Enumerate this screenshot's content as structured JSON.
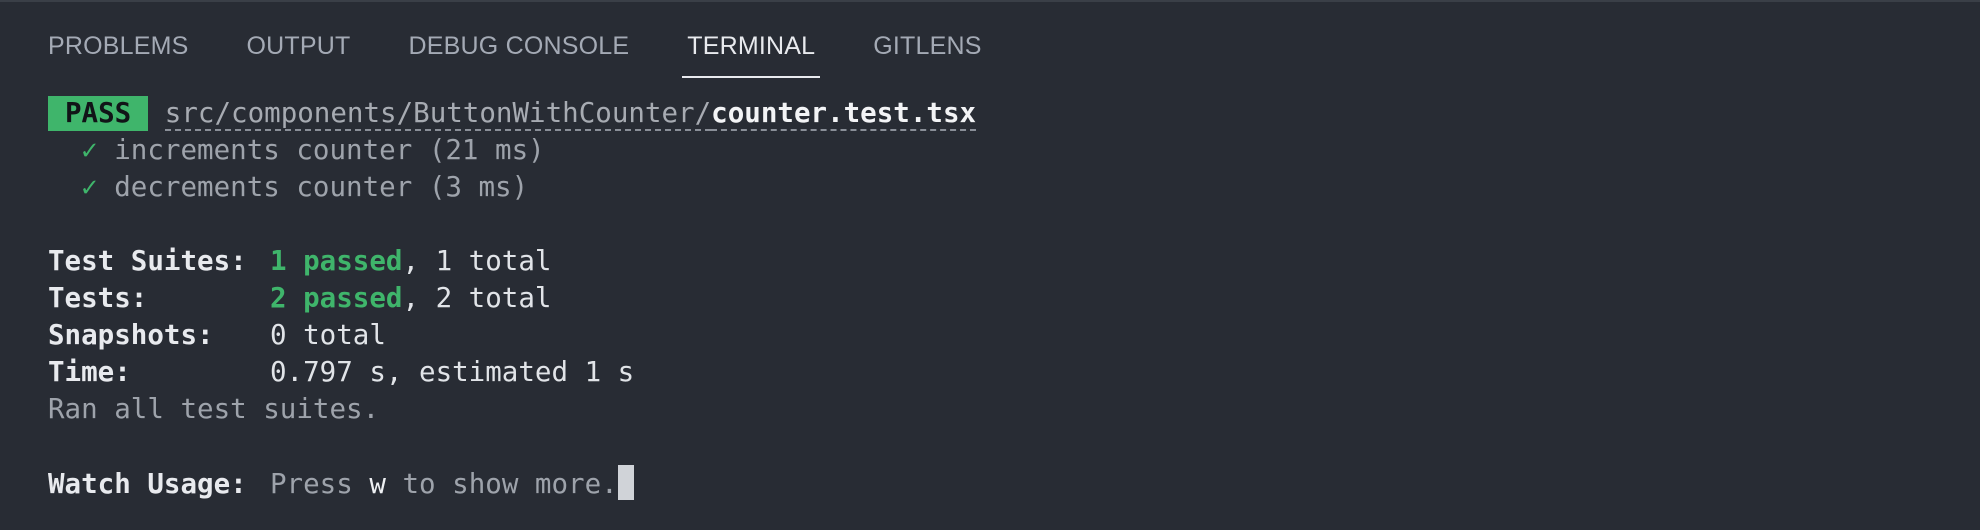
{
  "tabs": [
    {
      "label": "PROBLEMS"
    },
    {
      "label": "OUTPUT"
    },
    {
      "label": "DEBUG CONSOLE"
    },
    {
      "label": "TERMINAL",
      "active": true
    },
    {
      "label": "GITLENS"
    }
  ],
  "terminal": {
    "badge": "PASS",
    "path_dir": "src/components/ButtonWithCounter/",
    "path_file": "counter.test.tsx",
    "tests": [
      {
        "check": "✓",
        "text": "increments counter (21 ms)"
      },
      {
        "check": "✓",
        "text": "decrements counter (3 ms)"
      }
    ],
    "summary": {
      "suites_label": "Test Suites:",
      "suites_passed": "1 passed",
      "suites_total": ", 1 total",
      "tests_label": "Tests:",
      "tests_passed": "2 passed",
      "tests_total": ", 2 total",
      "snapshots_label": "Snapshots:",
      "snapshots_value": "0 total",
      "time_label": "Time:",
      "time_value": "0.797 s, estimated 1 s",
      "ran_all": "Ran all test suites."
    },
    "watch": {
      "label": "Watch Usage:",
      "press": "Press",
      "key": "w",
      "rest": "to show more."
    }
  },
  "colors": {
    "background": "#282c34",
    "pass_green": "#3fb56b"
  }
}
